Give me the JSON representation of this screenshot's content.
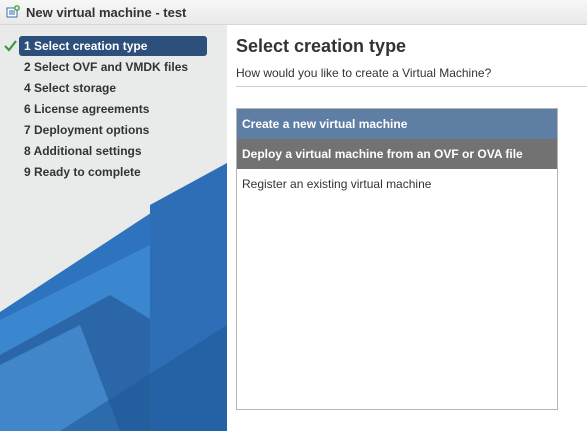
{
  "window": {
    "title": "New virtual machine - test"
  },
  "sidebar": {
    "steps": [
      {
        "label": "1 Select creation type",
        "active": true,
        "completed": true
      },
      {
        "label": "2 Select OVF and VMDK files"
      },
      {
        "label": "4 Select storage"
      },
      {
        "label": "6 License agreements"
      },
      {
        "label": "7 Deployment options"
      },
      {
        "label": "8 Additional settings"
      },
      {
        "label": "9 Ready to complete"
      }
    ]
  },
  "main": {
    "title": "Select creation type",
    "subtitle": "How would you like to create a Virtual Machine?",
    "options": [
      {
        "label": "Create a new virtual machine",
        "state": "hover"
      },
      {
        "label": "Deploy a virtual machine from an OVF or OVA file",
        "state": "selected"
      },
      {
        "label": "Register an existing virtual machine",
        "state": "normal"
      }
    ]
  },
  "icons": {
    "title": "new-vm-icon",
    "completed_step": "checkmark-icon"
  },
  "colors": {
    "active_step_bg": "#2d4f7b",
    "option_hover_bg": "#5f7ea4",
    "option_selected_bg": "#727272",
    "checkmark": "#3b9b3b",
    "sidebar_bg": "#e9eaea",
    "sidebar_art_blue": "#2b6cb2"
  }
}
